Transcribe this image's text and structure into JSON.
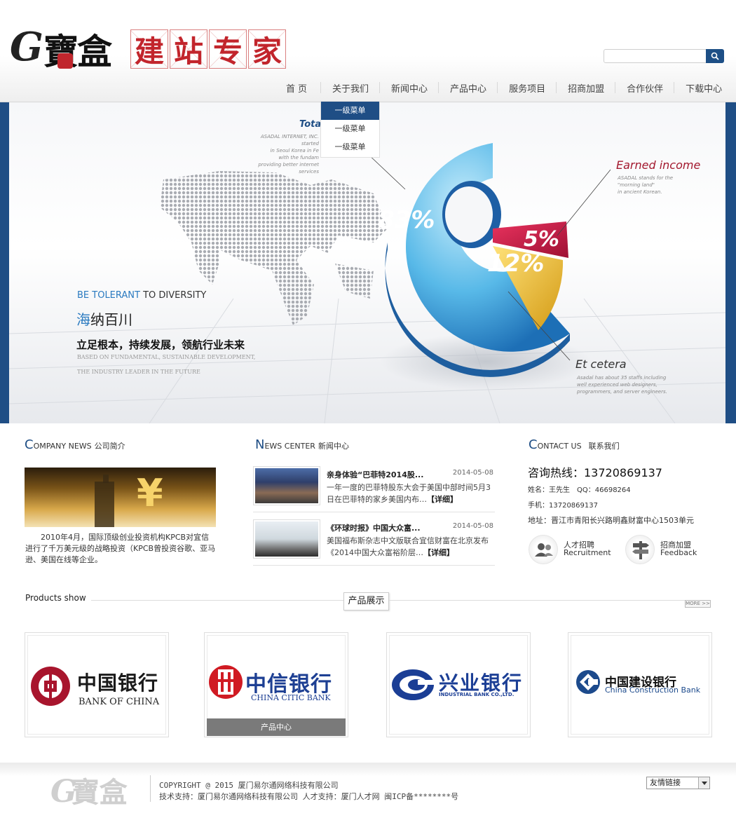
{
  "header": {
    "logo_letter": "G",
    "logo_text": "寶盒",
    "slogan_chars": [
      "建",
      "站",
      "专",
      "家"
    ],
    "search": {
      "placeholder": ""
    }
  },
  "nav": {
    "items": [
      {
        "label": "首页"
      },
      {
        "label": "关于我们"
      },
      {
        "label": "新闻中心"
      },
      {
        "label": "产品中心"
      },
      {
        "label": "服务项目"
      },
      {
        "label": "招商加盟"
      },
      {
        "label": "合作伙伴"
      },
      {
        "label": "下载中心"
      }
    ],
    "dropdown": [
      "一级菜单",
      "一级菜单",
      "一级菜单"
    ]
  },
  "banner": {
    "tag_blue": "BE TOLERANT",
    "tag_rest": " TO DIVERSITY",
    "title_blue": "海",
    "title_rest": "纳百川",
    "subtitle": "立足根本，持续发展，领航行业未来",
    "en_line1": "BASED ON FUNDAMENTAL, SUSTAINABLE DEVELOPMENT,",
    "en_line2": "THE INDUSTRY LEADER IN THE FUTURE",
    "total_label": "Total",
    "total_desc": [
      "ASADAL INTERNET, INC. started",
      "in Seoul Korea in Fe",
      "with the fundam",
      "providing better internet services"
    ],
    "earned_label": "Earned income",
    "earned_desc": [
      "ASADAL stands for the",
      "\"morning land\"",
      "in ancient Korean."
    ],
    "etc_label": "Et cetera",
    "etc_desc": [
      "Asadal has about 35 staffs including",
      "well experienced web designers,",
      "programmers, and server engineers."
    ],
    "pct_large": "83%",
    "pct_mid": "12%",
    "pct_small": "5%"
  },
  "company": {
    "title_cap": "C",
    "title_rest": "OMPANY NEWS",
    "title_cn": "公司简介",
    "text": "2010年4月，国际顶级创业投资机构KPCB对宜信进行了千万美元级的战略投资（KPCB曾投资谷歌、亚马逊、美国在线等企业。"
  },
  "news": {
    "title_cap": "N",
    "title_rest": "EWS CENTER",
    "title_cn": "新闻中心",
    "items": [
      {
        "title": "亲身体验“巴菲特2014股...",
        "date": "2014-05-08",
        "summary": "一年一度的巴菲特股东大会于美国中部时间5月3日在巴菲特的家乡美国内布…",
        "more": "【详细】"
      },
      {
        "title": "《环球时报》中国大众富...",
        "date": "2014-05-08",
        "summary": "美国福布斯杂志中文版联合宜信财富在北京发布《2014中国大众富裕阶层…",
        "more": "【详细】"
      }
    ]
  },
  "contact": {
    "title_cap": "C",
    "title_rest": "ONTACT US",
    "title_cn": "联系我们",
    "hotline": "咨询热线：13720869137",
    "name": "姓名：王先生　QQ：46698264",
    "phone": "手机：13720869137",
    "address": "地址：晋江市青阳长兴路明鑫财富中心1503单元",
    "btn1_cn": "人才招聘",
    "btn1_en": "Recruitment",
    "btn2_cn": "招商加盟",
    "btn2_en": "Feedback"
  },
  "products": {
    "title_en": "Products show",
    "title_cn": "产品展示",
    "more": "MORE >>",
    "items": [
      {
        "cn": "中国银行",
        "en": "BANK OF CHINA",
        "color": "#a8152d"
      },
      {
        "cn": "中信银行",
        "en": "CHINA CITIC BANK",
        "color": "#1d3f93",
        "caption": "产品中心"
      },
      {
        "cn": "兴业银行",
        "en": "INDUSTRIAL BANK CO.,LTD.",
        "color": "#1b3e95"
      },
      {
        "cn": "中国建设银行",
        "en": "China Construction Bank",
        "color": "#1c4a8c"
      }
    ]
  },
  "footer": {
    "copyright": "COPYRIGHT @ 2015 厦门易尔通网络科技有限公司",
    "support": "技术支持：厦门易尔通网络科技有限公司 人才支持：厦门人才网 闽ICP备********号",
    "links_select": "友情链接"
  },
  "colors": {
    "brand": "#1f4e85",
    "red": "#c2252c"
  }
}
